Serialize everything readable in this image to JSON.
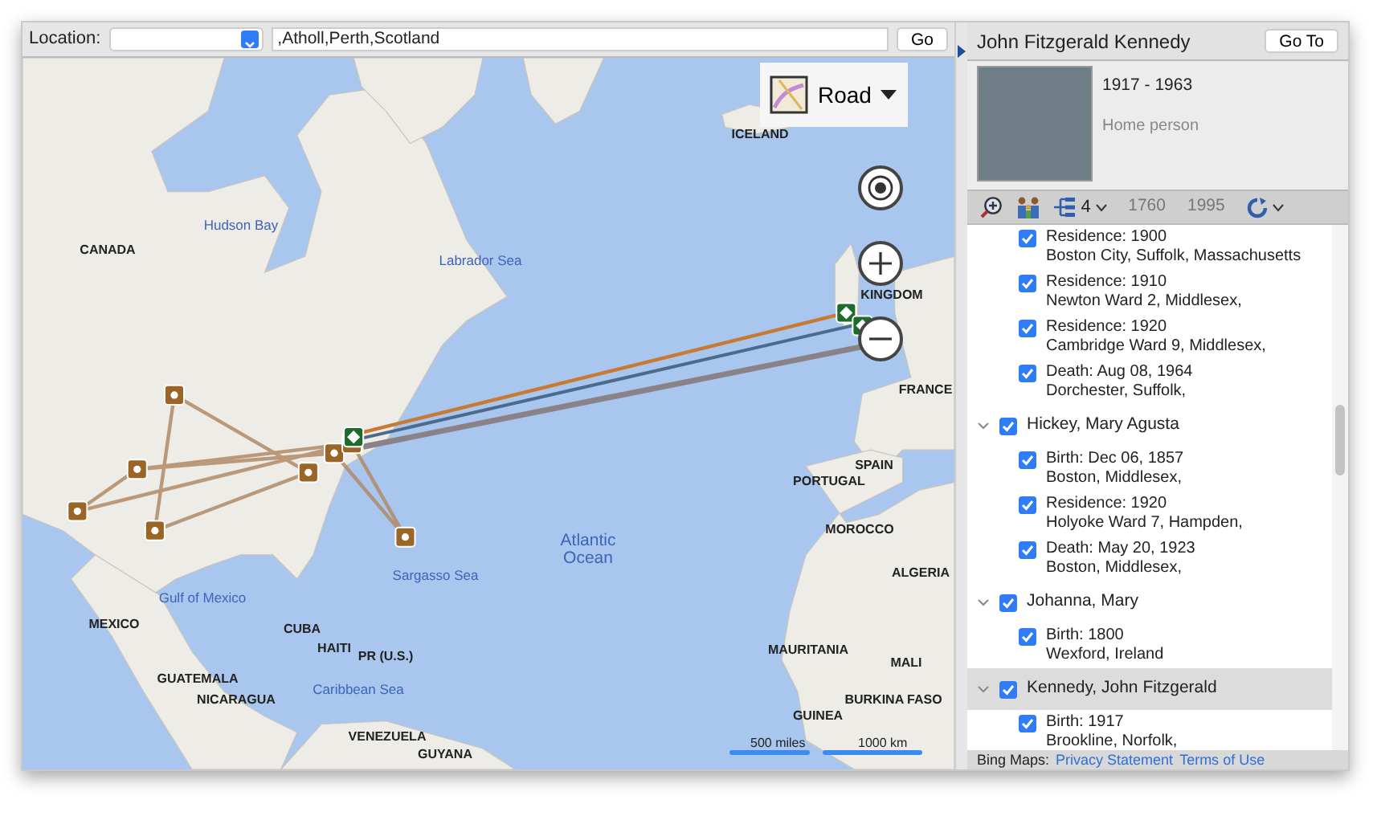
{
  "location_bar": {
    "label": "Location:",
    "query": ",Atholl,Perth,Scotland",
    "go": "Go"
  },
  "map": {
    "style_button": "Road",
    "labels": [
      {
        "text": "ICELAND",
        "kind": "country"
      },
      {
        "text": "Hudson Bay",
        "kind": "water"
      },
      {
        "text": "CANADA",
        "kind": "country"
      },
      {
        "text": "Labrador Sea",
        "kind": "water"
      },
      {
        "text": "KINGDOM",
        "kind": "country"
      },
      {
        "text": "FRANCE",
        "kind": "country"
      },
      {
        "text": "SPAIN",
        "kind": "country"
      },
      {
        "text": "PORTUGAL",
        "kind": "country"
      },
      {
        "text": "MOROCCO",
        "kind": "country"
      },
      {
        "text": "Atlantic Ocean",
        "kind": "water"
      },
      {
        "text": "Sargasso Sea",
        "kind": "water"
      },
      {
        "text": "ALGERIA",
        "kind": "country"
      },
      {
        "text": "Gulf of Mexico",
        "kind": "water"
      },
      {
        "text": "MEXICO",
        "kind": "country"
      },
      {
        "text": "CUBA",
        "kind": "country"
      },
      {
        "text": "HAITI",
        "kind": "country"
      },
      {
        "text": "PR (U.S.)",
        "kind": "country"
      },
      {
        "text": "MAURITANIA",
        "kind": "country"
      },
      {
        "text": "MALI",
        "kind": "country"
      },
      {
        "text": "GUATEMALA",
        "kind": "country"
      },
      {
        "text": "Caribbean Sea",
        "kind": "water"
      },
      {
        "text": "NICARAGUA",
        "kind": "country"
      },
      {
        "text": "BURKINA FASO",
        "kind": "country"
      },
      {
        "text": "GUINEA",
        "kind": "country"
      },
      {
        "text": "VENEZUELA",
        "kind": "country"
      },
      {
        "text": "GUYANA",
        "kind": "country"
      }
    ],
    "scale": [
      "500 miles",
      "1000 km"
    ]
  },
  "person": {
    "name": "John Fitzgerald Kennedy",
    "go_to": "Go To",
    "dates": "1917 - 1963",
    "role": "Home person"
  },
  "toolbar": {
    "generations": "4",
    "start_year": "1760",
    "end_year": "1995"
  },
  "tree": {
    "events": [
      {
        "title": "Residence: 1900",
        "place": "Boston City, Suffolk, Massachusetts",
        "checked": true
      },
      {
        "title": "Residence: 1910",
        "place": "Newton Ward 2, Middlesex,",
        "checked": true
      },
      {
        "title": "Residence: 1920",
        "place": "Cambridge Ward 9, Middlesex,",
        "checked": true
      },
      {
        "title": "Death: Aug 08, 1964",
        "place": "Dorchester, Suffolk,",
        "checked": true
      }
    ],
    "people": [
      {
        "name": "Hickey, Mary Agusta",
        "checked": true,
        "expanded": true,
        "selected": false,
        "children": [
          {
            "title": "Birth: Dec 06, 1857",
            "place": "Boston, Middlesex,",
            "checked": true
          },
          {
            "title": "Residence: 1920",
            "place": "Holyoke Ward 7, Hampden,",
            "checked": true
          },
          {
            "title": "Death: May 20, 1923",
            "place": "Boston, Middlesex,",
            "checked": true
          }
        ]
      },
      {
        "name": "Johanna, Mary",
        "checked": true,
        "expanded": true,
        "selected": false,
        "children": [
          {
            "title": "Birth: 1800",
            "place": "Wexford, Ireland",
            "checked": true
          }
        ]
      },
      {
        "name": "Kennedy, John Fitzgerald",
        "checked": true,
        "expanded": true,
        "selected": true,
        "children": [
          {
            "title": "Birth: 1917",
            "place": "Brookline, Norfolk,",
            "checked": true
          }
        ]
      }
    ]
  },
  "footer": {
    "label": "Bing Maps:",
    "links": [
      "Privacy Statement",
      "Terms of Use"
    ]
  }
}
